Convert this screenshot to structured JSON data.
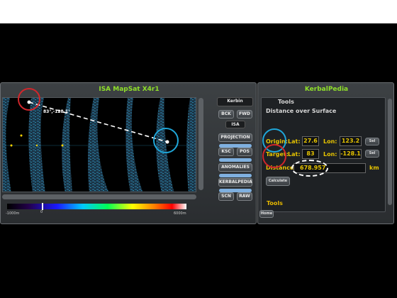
{
  "mapsat": {
    "title": "ISA MapSat X4r1",
    "coord_label": "83°,-128.1°",
    "legend_min": "-1000m",
    "legend_mid": "0",
    "legend_max": "6000m",
    "buttons": {
      "planet": "Kerbin",
      "bck": "BCK",
      "fwd": "FWD",
      "isa": "ISA",
      "projection": "PROJECTION",
      "ksc": "KSC",
      "pos": "POS",
      "anomalies": "ANOMALIES",
      "kerbalpedia": "KERBALPEDIA",
      "scn": "SCN",
      "raw": "RAW"
    }
  },
  "kerbalpedia": {
    "title": "KerbalPedia",
    "tools_heading": "Tools",
    "section": "Distance over Surface",
    "origin": {
      "label": "Origin:",
      "lat_label": "Lat:",
      "lat": "27.6",
      "lon_label": "Lon:",
      "lon": "123.2",
      "sel": "Sel"
    },
    "target": {
      "label": "Target:",
      "lat_label": "Lat:",
      "lat": "83",
      "lon_label": "Lon:",
      "lon": "-128.1",
      "sel": "Sel"
    },
    "distance_label": "Distance:",
    "distance_value": "678.957",
    "distance_unit": "km",
    "calculate": "Calculate",
    "tools_footer": "Tools",
    "home": "Home"
  },
  "colors": {
    "title_green": "#8fe02a",
    "value_gold": "#e6c300",
    "annotation_red": "#d0262b",
    "annotation_blue": "#1fa6d8"
  }
}
